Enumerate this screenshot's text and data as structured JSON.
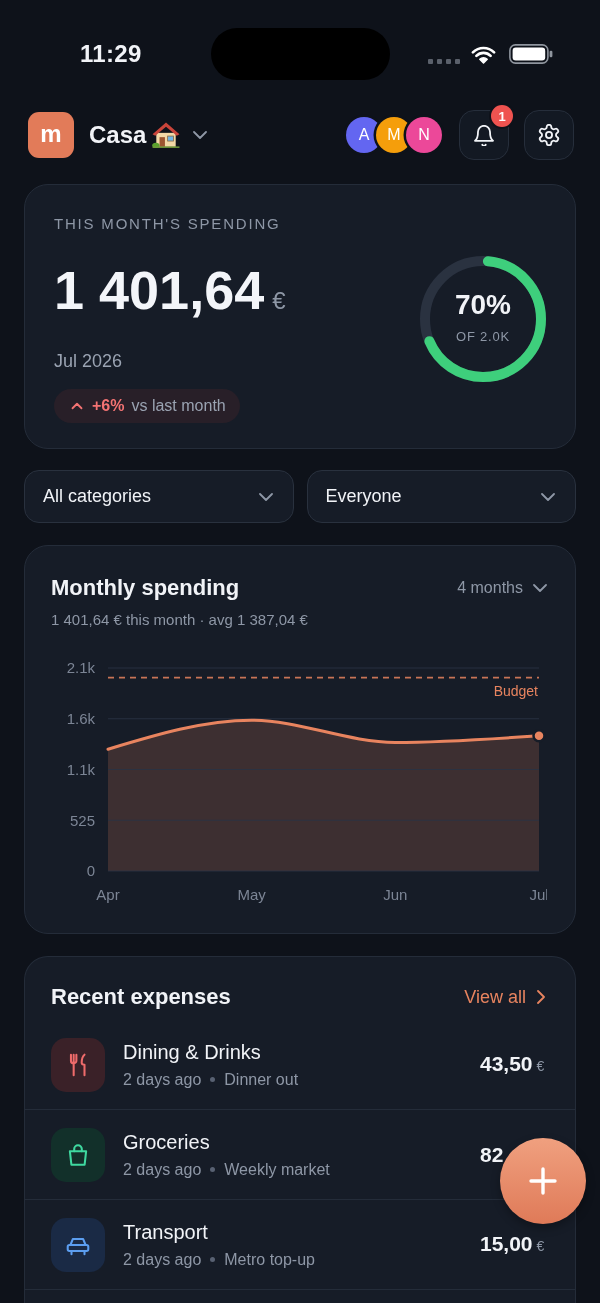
{
  "status_bar": {
    "time": "11:29"
  },
  "header": {
    "household_initial": "m",
    "household_name": "Casa",
    "members": [
      {
        "initial": "A",
        "color": "#6366f1"
      },
      {
        "initial": "M",
        "color": "#f59e0b"
      },
      {
        "initial": "N",
        "color": "#ec4899"
      }
    ],
    "notification_count": "1"
  },
  "spending_card": {
    "label": "THIS MONTH'S SPENDING",
    "amount": "1 401,64",
    "currency": "€",
    "period": "Jul 2026",
    "trend": {
      "increase": true,
      "change": "+6%",
      "text": "vs last month"
    },
    "budget_ring": {
      "level": 0.7,
      "percent": "70%",
      "caption": "OF 2.0K"
    }
  },
  "filters": [
    {
      "label": "All categories"
    },
    {
      "label": "Everyone"
    }
  ],
  "chart_card": {
    "title": "Monthly spending",
    "range": "4 months",
    "summary": "1 401,64 € this month · avg 1 387,04 €",
    "chart_data": {
      "type": "area",
      "categories": [
        "Apr",
        "May",
        "Jun",
        "Jul"
      ],
      "series": [
        {
          "color": "#e8845f",
          "values": [
            1260,
            1560,
            1330,
            1400
          ]
        }
      ],
      "ylim": [
        0,
        2100
      ],
      "yticks": [
        0,
        525,
        {
          "value": 1050,
          "label": "1.1k"
        },
        {
          "value": 1575,
          "label": "1.6k"
        },
        {
          "value": 2100,
          "label": "2.1k"
        }
      ],
      "grid": true,
      "ref_lines": [
        {
          "axis": "y",
          "value": 2000,
          "label": "Budget"
        }
      ]
    }
  },
  "recent_expenses": {
    "title": "Recent expenses",
    "view_all": "View all",
    "items": [
      {
        "kind": "dining",
        "title": "Dining & Drinks",
        "when": "2 days ago",
        "note": "Dinner out",
        "amount": "43,50",
        "currency": "€"
      },
      {
        "kind": "groceries",
        "title": "Groceries",
        "when": "2 days ago",
        "note": "Weekly market",
        "amount": "82"
      },
      {
        "kind": "transport",
        "title": "Transport",
        "when": "2 days ago",
        "note": "Metro top-up",
        "amount": "15,00",
        "currency": "€"
      }
    ]
  }
}
